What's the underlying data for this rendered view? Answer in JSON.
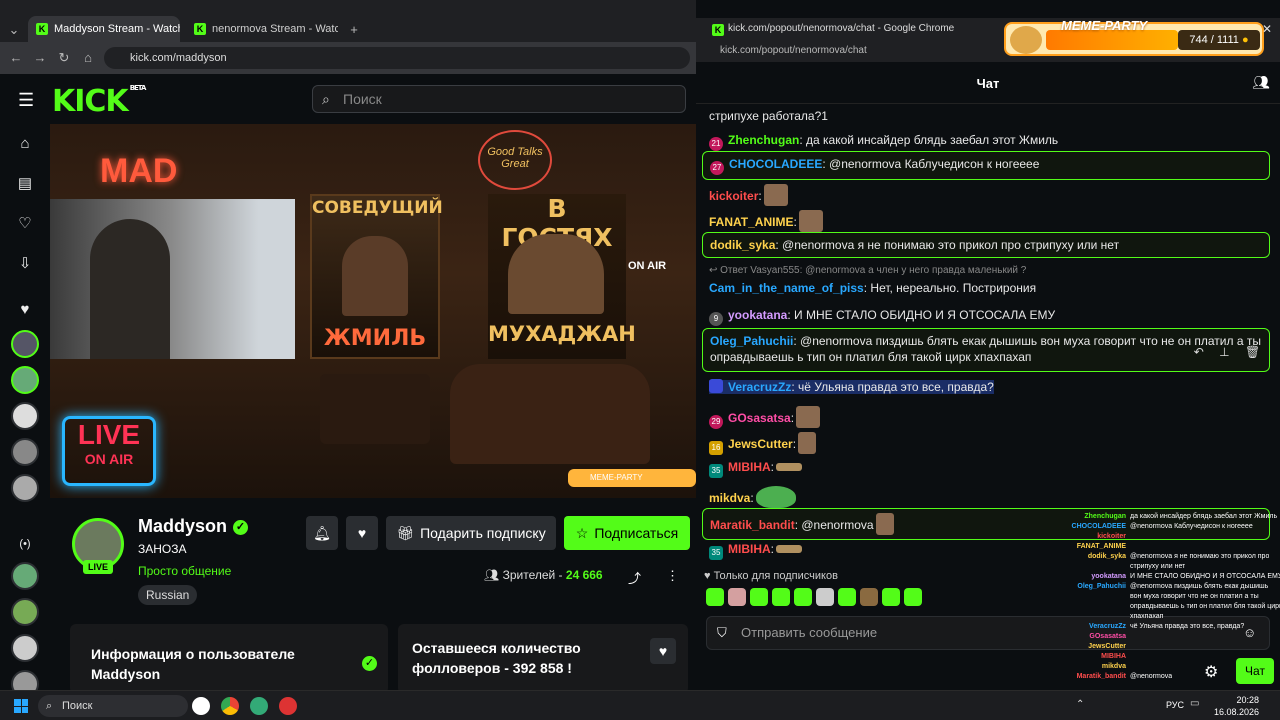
{
  "browser": {
    "tabs": [
      {
        "label": "Maddyson Stream - Watch"
      },
      {
        "label": "nenormova Stream - Watch Liv"
      }
    ],
    "url": "kick.com/maddyson"
  },
  "kick": {
    "logo": "KICK",
    "logo_beta": "BETA",
    "search_placeholder": "Поиск",
    "video": {
      "mad_sign": "MAD",
      "poster1_title": "СОВЕДУЩИЙ",
      "poster1_sub": "ЖМИЛЬ",
      "good_talks": "Good Talks Great",
      "poster2_title": "В ГОСТЯХ",
      "poster2_sub": "МУХАДЖАН",
      "on_air": "ON AIR",
      "live_neon": "LIVE",
      "live_neon_sub": "ON AIR",
      "meme_mini": "MEME-PARTY"
    },
    "streamer": {
      "name": "Maddyson",
      "title": "ЗАНОЗА",
      "category": "Просто общение",
      "language": "Russian",
      "live_badge": "LIVE",
      "gift_label": "Подарить подписку",
      "subscribe_label": "Подписаться",
      "viewers_label": "Зрителей - ",
      "viewers_value": "24 666"
    },
    "cards": {
      "about_title": "Информация о пользователе Maddyson",
      "followers_title": "Оставшееся количество фолловеров - 392 858 !"
    }
  },
  "chat": {
    "window_title": "kick.com/popout/nenormova/chat - Google Chrome",
    "url": "kick.com/popout/nenormova/chat",
    "header": "Чат",
    "messages": [
      {
        "user": "",
        "text": "стрипухе работала?1",
        "color": "#e8e8e8"
      },
      {
        "user": "Zhenchugan",
        "text": ": да какой инсайдер блядь заебал этот Жмиль",
        "color": "#53fc18",
        "badge": "21",
        "badge_color": "#c2185b"
      },
      {
        "user": "CHOCOLADEEE",
        "text": ": @nenormova Каблучедисон к ногееее",
        "color": "#29a8ff",
        "badge": "27",
        "badge_color": "#c2185b"
      },
      {
        "user": "kickoiter",
        "text": ":",
        "color": "#ff4d4d"
      },
      {
        "user": "FANAT_ANIME",
        "text": ":",
        "color": "#ffd24d"
      },
      {
        "user": "dodik_syka",
        "text": ": @nenormova я не понимаю это прикол про стрипуху или нет",
        "color": "#ffd24d"
      },
      {
        "user": "",
        "text": "↩ Ответ Vasyan555: @nenormova а член у него правда маленький ?",
        "color": "#888"
      },
      {
        "user": "Cam_in_the_name_of_piss",
        "text": ": Нет, нереально. Пострирония",
        "color": "#29a8ff"
      },
      {
        "user": "yookatana",
        "text": ": И МНЕ СТАЛО ОБИДНО И Я ОТСОСАЛА ЕМУ",
        "color": "#d49bff",
        "badge": "9",
        "badge_color": "#555"
      },
      {
        "user": "Oleg_Pahuchii",
        "text": ": @nenormova пиздишь блять екак дышишь вон муха говорит что не он платил а ты оправдываешь ь тип он платил бля такой цирк хпахпахап",
        "color": "#29a8ff"
      },
      {
        "user": "VeracruzZz",
        "text": ": чё Ульяна правда это все, правда?",
        "color": "#29a8ff"
      },
      {
        "user": "GOsasatsa",
        "text": ":",
        "color": "#ff4da6",
        "badge": "29",
        "badge_color": "#c2185b"
      },
      {
        "user": "JewsCutter",
        "text": ":",
        "color": "#ffd24d",
        "badge": "16",
        "badge_color": "#d4a000"
      },
      {
        "user": "MIBIHA",
        "text": ":",
        "color": "#ff4d4d",
        "badge": "35",
        "badge_color": "#00897b"
      },
      {
        "user": "mikdva",
        "text": ":",
        "color": "#ffd24d"
      },
      {
        "user": "Maratik_bandit",
        "text": ": @nenormova",
        "color": "#ff4d4d"
      },
      {
        "user": "MIBIHA",
        "text": ":",
        "color": "#ff4d4d",
        "badge": "35",
        "badge_color": "#00897b"
      }
    ],
    "sub_only": "♥ Только для подписчиков",
    "input_placeholder": "Отправить сообщение",
    "send_label": "Чат"
  },
  "overlay": {
    "rows": [
      {
        "name": "Zhenchugan",
        "text": "да какой инсайдер блядь заебал этот Жмиль",
        "color": "#53fc18"
      },
      {
        "name": "CHOCOLADEEE",
        "text": "@nenormova Каблучедисон к ногееее",
        "color": "#29a8ff"
      },
      {
        "name": "kickoiter",
        "text": "",
        "color": "#ff4d4d"
      },
      {
        "name": "FANAT_ANIME",
        "text": "",
        "color": "#ffd24d"
      },
      {
        "name": "dodik_syka",
        "text": "@nenormova я не понимаю это прикол про",
        "color": "#ffd24d"
      },
      {
        "name": "",
        "text": "стрипуху или нет",
        "color": "#fff"
      },
      {
        "name": "yookatana",
        "text": "И МНЕ СТАЛО ОБИДНО И Я ОТСОСАЛА ЕМУ",
        "color": "#d49bff"
      },
      {
        "name": "Oleg_Pahuchii",
        "text": "@nenormova пиздишь блять екак дышишь",
        "color": "#29a8ff"
      },
      {
        "name": "",
        "text": "вон муха говорит что не он платил а ты",
        "color": "#fff"
      },
      {
        "name": "",
        "text": "оправдываешь ь тип он платил бля такой цирк",
        "color": "#fff"
      },
      {
        "name": "",
        "text": "хпахпахап",
        "color": "#fff"
      },
      {
        "name": "VeracruzZz",
        "text": "чё Ульяна правда это все, правда?",
        "color": "#29a8ff"
      },
      {
        "name": "GOsasatsa",
        "text": "",
        "color": "#ff4da6"
      },
      {
        "name": "JewsCutter",
        "text": "",
        "color": "#ffd24d"
      },
      {
        "name": "MIBIHA",
        "text": "",
        "color": "#ff4d4d"
      },
      {
        "name": "mikdva",
        "text": "",
        "color": "#ffd24d"
      },
      {
        "name": "Maratik_bandit",
        "text": "@nenormova",
        "color": "#ff4d4d"
      }
    ]
  },
  "meme_party": {
    "title": "MEME-PARTY",
    "count": "744 / 1111"
  },
  "taskbar": {
    "search": "Поиск",
    "lang": "РУС",
    "time": "20:28",
    "date": "16.08.2026"
  }
}
